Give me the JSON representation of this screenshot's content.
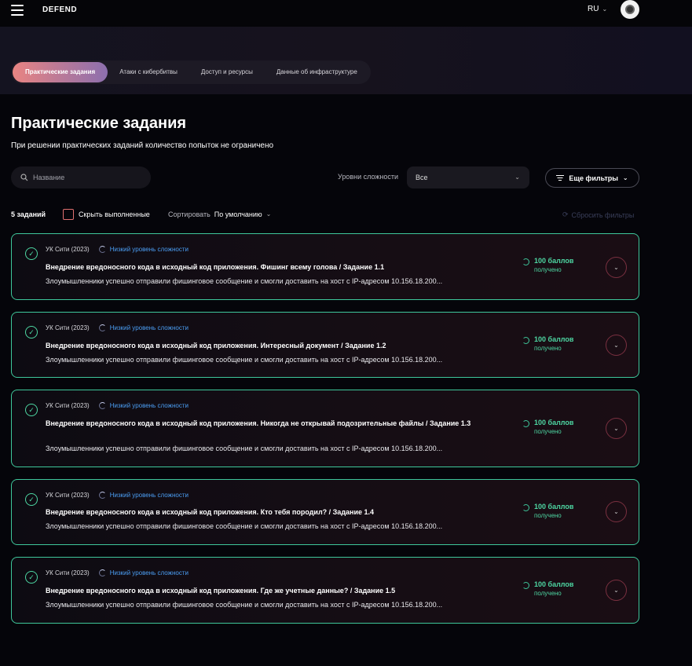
{
  "header": {
    "logo": "DEFEND",
    "language": "RU"
  },
  "tabs": [
    {
      "label": "Практические задания",
      "active": true
    },
    {
      "label": "Атаки с кибербитвы",
      "active": false
    },
    {
      "label": "Доступ и ресурсы",
      "active": false
    },
    {
      "label": "Данные об инфраструктуре",
      "active": false
    }
  ],
  "page": {
    "title": "Практические задания",
    "subtitle": "При решении практических заданий количество попыток не ограничено"
  },
  "filters": {
    "search_placeholder": "Название",
    "difficulty_label": "Уровни сложности",
    "difficulty_value": "Все",
    "more_filters": "Еще фильтры"
  },
  "summary": {
    "count": "5 заданий",
    "hide_completed": "Скрыть выполненные",
    "sort_label": "Сортировать",
    "sort_value": "По умолчанию",
    "reset": "Сбросить фильтры"
  },
  "tasks": [
    {
      "org": "УК Сити (2023)",
      "difficulty": "Низкий уровень сложности",
      "title": "Внедрение вредоносного кода в исходный код приложения. Фишинг всему голова / Задание 1.1",
      "description": "Злоумышленники успешно отправили фишинговое сообщение и смогли доставить на хост с IP-адресом 10.156.18.200...",
      "points": "100 баллов",
      "status": "получено"
    },
    {
      "org": "УК Сити (2023)",
      "difficulty": "Низкий уровень сложности",
      "title": "Внедрение вредоносного кода в исходный код приложения. Интересный документ / Задание 1.2",
      "description": "Злоумышленники успешно отправили фишинговое сообщение и смогли доставить на хост с IP-адресом 10.156.18.200...",
      "points": "100 баллов",
      "status": "получено"
    },
    {
      "org": "УК Сити (2023)",
      "difficulty": "Низкий уровень сложности",
      "title": "Внедрение вредоносного кода в исходный код приложения. Никогда не открывай подозрительные файлы / Задание 1.3",
      "description": "Злоумышленники успешно отправили фишинговое сообщение и смогли доставить на хост с IP-адресом 10.156.18.200...",
      "points": "100 баллов",
      "status": "получено"
    },
    {
      "org": "УК Сити (2023)",
      "difficulty": "Низкий уровень сложности",
      "title": "Внедрение вредоносного кода в исходный код приложения. Кто тебя породил? / Задание 1.4",
      "description": "Злоумышленники успешно отправили фишинговое сообщение и смогли доставить на хост с IP-адресом 10.156.18.200...",
      "points": "100 баллов",
      "status": "получено"
    },
    {
      "org": "УК Сити (2023)",
      "difficulty": "Низкий уровень сложности",
      "title": "Внедрение вредоносного кода в исходный код приложения. Где же учетные данные? / Задание 1.5",
      "description": "Злоумышленники успешно отправили фишинговое сообщение и смогли доставить на хост с IP-адресом 10.156.18.200...",
      "points": "100 баллов",
      "status": "получено"
    }
  ],
  "colors": {
    "accent_green": "#3ec79b",
    "difficulty_blue": "#4b9ef3",
    "tab_gradient_start": "#e98482",
    "tab_gradient_end": "#8c6fae"
  }
}
